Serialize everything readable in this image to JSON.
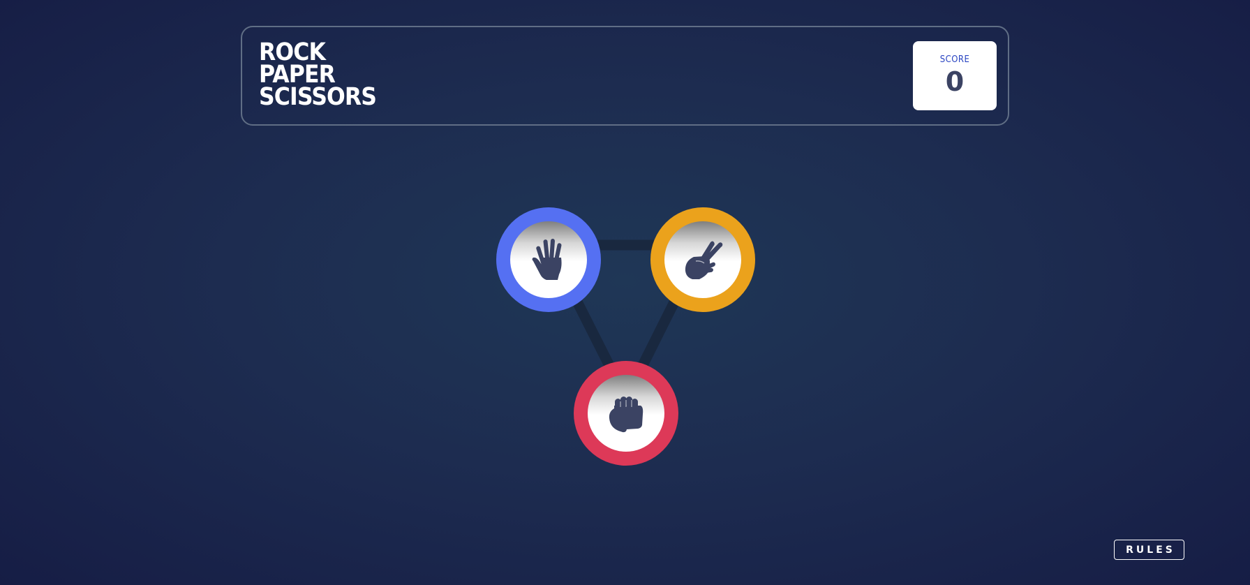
{
  "header": {
    "title_lines": [
      "ROCK",
      "PAPER",
      "SCISSORS"
    ],
    "score_label": "SCORE",
    "score_value": "0"
  },
  "tokens": [
    {
      "name": "paper",
      "icon": "paper-hand-icon",
      "ring_color": "#5570f2"
    },
    {
      "name": "scissors",
      "icon": "scissors-hand-icon",
      "ring_color": "#eba21c"
    },
    {
      "name": "rock",
      "icon": "rock-fist-icon",
      "ring_color": "#dd3958"
    }
  ],
  "colors": {
    "background": "#1d2c50",
    "icon": "#3b4363",
    "score_label": "#2a45c2"
  },
  "rules_button": {
    "label": "RULES"
  }
}
